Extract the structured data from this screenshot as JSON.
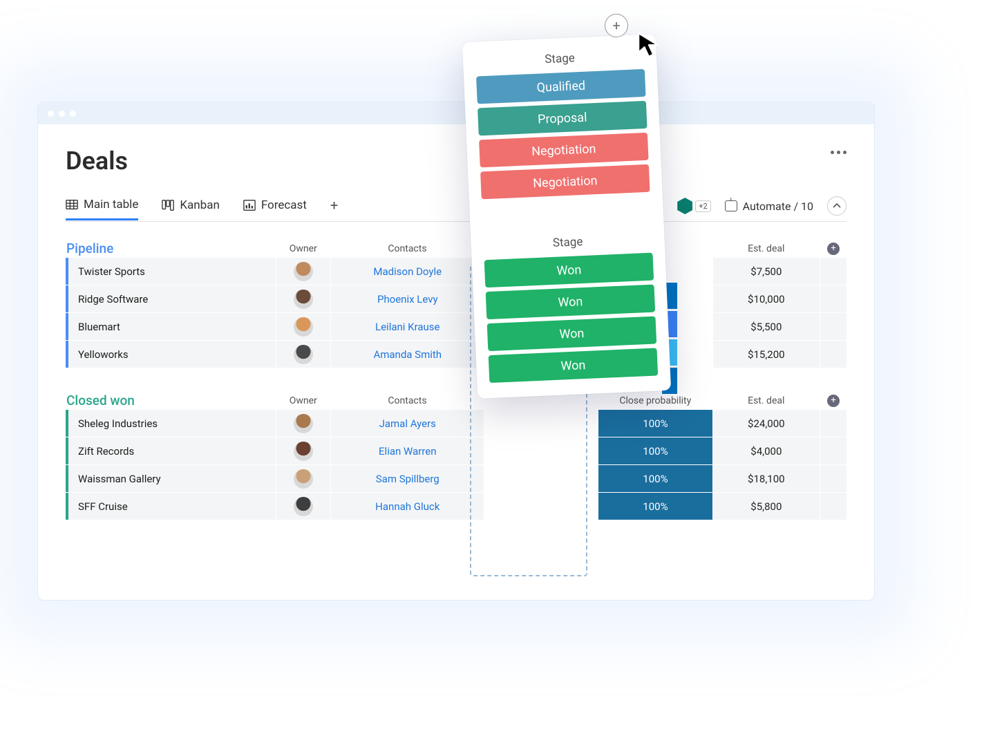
{
  "page": {
    "title": "Deals"
  },
  "tabs": {
    "items": [
      {
        "label": "Main table"
      },
      {
        "label": "Kanban"
      },
      {
        "label": "Forecast"
      }
    ],
    "overflow_badge": "+2",
    "automate": "Automate / 10"
  },
  "groups": {
    "pipeline": {
      "title": "Pipeline",
      "columns": {
        "owner": "Owner",
        "contacts": "Contacts",
        "est": "Est. deal"
      },
      "rows": [
        {
          "name": "Twister Sports",
          "owner_color": "#c08a5d",
          "contact": "Madison Doyle",
          "prio": "#0073c2",
          "est": "$7,500"
        },
        {
          "name": "Ridge Software",
          "owner_color": "#6b4b3a",
          "contact": "Phoenix Levy",
          "prio": "#3b82f6",
          "est": "$10,000"
        },
        {
          "name": "Bluemart",
          "owner_color": "#d9975a",
          "contact": "Leilani Krause",
          "prio": "#38bdf8",
          "est": "$5,500"
        },
        {
          "name": "Yelloworks",
          "owner_color": "#4a4a4a",
          "contact": "Amanda Smith",
          "prio": "#0073c2",
          "est": "$15,200"
        }
      ]
    },
    "closed_won": {
      "title": "Closed won",
      "columns": {
        "owner": "Owner",
        "contacts": "Contacts",
        "prob": "Close probability",
        "est": "Est. deal"
      },
      "rows": [
        {
          "name": "Sheleg Industries",
          "owner_color": "#a9794d",
          "contact": "Jamal Ayers",
          "prob": "100%",
          "est": "$24,000"
        },
        {
          "name": "Zift Records",
          "owner_color": "#6b4030",
          "contact": "Elian Warren",
          "prob": "100%",
          "est": "$4,000"
        },
        {
          "name": "Waissman Gallery",
          "owner_color": "#caa078",
          "contact": "Sam Spillberg",
          "prob": "100%",
          "est": "$18,100"
        },
        {
          "name": "SFF Cruise",
          "owner_color": "#3e3e3e",
          "contact": "Hannah Gluck",
          "prob": "100%",
          "est": "$5,800"
        }
      ]
    }
  },
  "stage_card": {
    "title_a": "Stage",
    "title_b": "Stage",
    "top": [
      {
        "label": "Qualified",
        "color": "#4f9bbf"
      },
      {
        "label": "Proposal",
        "color": "#3aa08f"
      },
      {
        "label": "Negotiation",
        "color": "#f0706e"
      },
      {
        "label": "Negotiation",
        "color": "#f0706e"
      }
    ],
    "bottom": [
      {
        "label": "Won",
        "color": "#1fb268"
      },
      {
        "label": "Won",
        "color": "#1fb268"
      },
      {
        "label": "Won",
        "color": "#1fb268"
      },
      {
        "label": "Won",
        "color": "#1fb268"
      }
    ]
  },
  "colors": {
    "prob_bg": "#1a6e9e"
  }
}
